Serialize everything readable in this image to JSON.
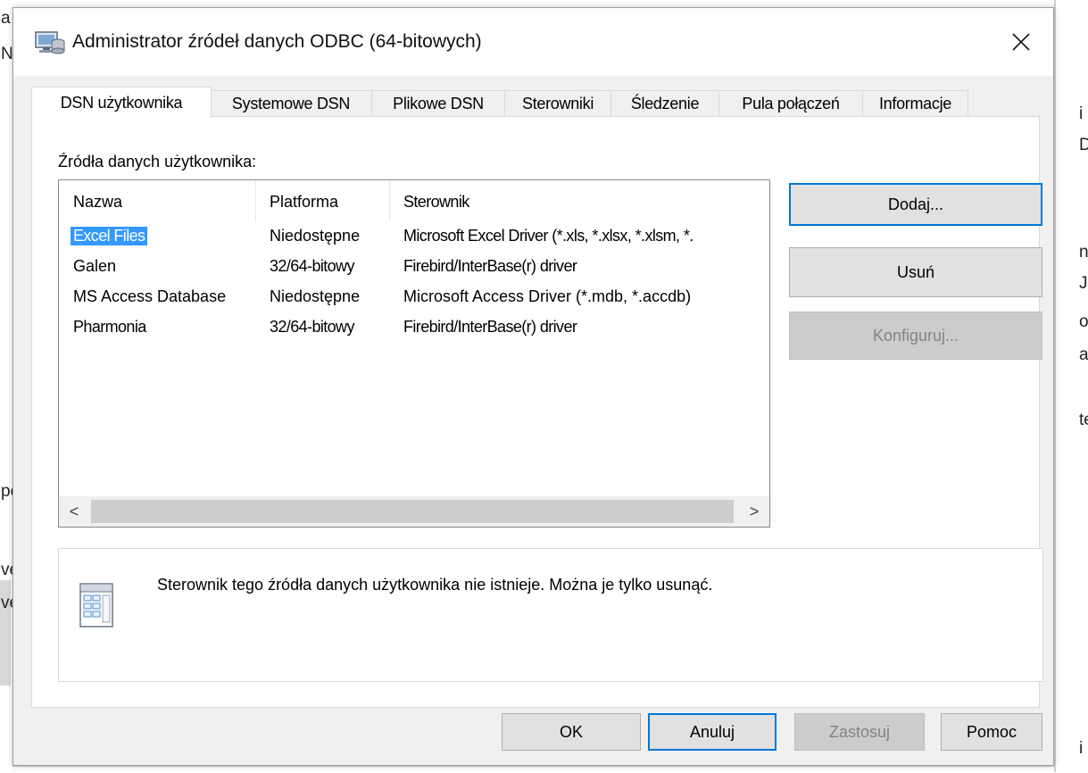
{
  "background": {
    "left_fragments": [
      "a",
      "N",
      "pe",
      "ve",
      "ve"
    ],
    "right_fragments": [
      "i",
      "D",
      "n",
      "J",
      "o",
      "a",
      "te",
      "i"
    ]
  },
  "dialog": {
    "title": "Administrator źródeł danych ODBC (64-bitowych)",
    "close_icon": "close-icon"
  },
  "tabs": [
    {
      "label": "DSN użytkownika",
      "active": true
    },
    {
      "label": "Systemowe DSN"
    },
    {
      "label": "Plikowe DSN"
    },
    {
      "label": "Sterowniki"
    },
    {
      "label": "Śledzenie"
    },
    {
      "label": "Pula połączeń"
    },
    {
      "label": "Informacje"
    }
  ],
  "panel": {
    "section_label": "Źródła danych użytkownika:",
    "columns": [
      "Nazwa",
      "Platforma",
      "Sterownik"
    ],
    "rows": [
      {
        "name": "Excel Files",
        "platform": "Niedostępne",
        "driver": "Microsoft Excel Driver (*.xls, *.xlsx, *.xlsm, *.",
        "selected": true
      },
      {
        "name": "Galen",
        "platform": "32/64-bitowy",
        "driver": "Firebird/InterBase(r) driver"
      },
      {
        "name": "MS Access Database",
        "platform": "Niedostępne",
        "driver": "Microsoft Access Driver (*.mdb, *.accdb)"
      },
      {
        "name": "Pharmonia",
        "platform": "32/64-bitowy",
        "driver": "Firebird/InterBase(r) driver"
      }
    ],
    "scroll_left": "<",
    "scroll_right": ">",
    "buttons": {
      "add": "Dodaj...",
      "remove": "Usuń",
      "configure": "Konfiguruj..."
    },
    "info_text": "Sterownik tego źródła danych użytkownika nie istnieje. Można je tylko usunąć."
  },
  "footer": {
    "ok": "OK",
    "cancel": "Anuluj",
    "apply": "Zastosuj",
    "help": "Pomoc"
  },
  "colors": {
    "selection": "#3399ff",
    "default_button_border": "#0078d7",
    "dialog_bg": "#f0f0f0"
  }
}
